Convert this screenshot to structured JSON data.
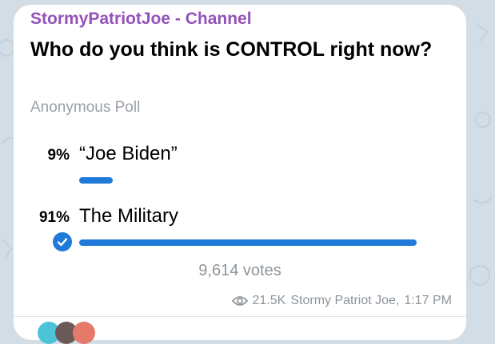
{
  "channel": {
    "name": "StormyPatriotJoe - Channel"
  },
  "poll": {
    "question": "Who do you think is CONTROL right now?",
    "type": "Anonymous Poll",
    "options": [
      {
        "percent": "9%",
        "text": "“Joe Biden”",
        "fraction": 0.09,
        "selected": false
      },
      {
        "percent": "91%",
        "text": "The Military",
        "fraction": 0.91,
        "selected": true
      }
    ],
    "votes": "9,614 votes"
  },
  "post_meta": {
    "views": "21.5K",
    "author": "Stormy Patriot Joe",
    "time": "1:17 PM",
    "views_icon": "eye-icon"
  },
  "colors": {
    "accent": "#1f7ad8",
    "channel_name": "#9452b8",
    "muted": "#8e959b",
    "background": "#d3dde6"
  }
}
